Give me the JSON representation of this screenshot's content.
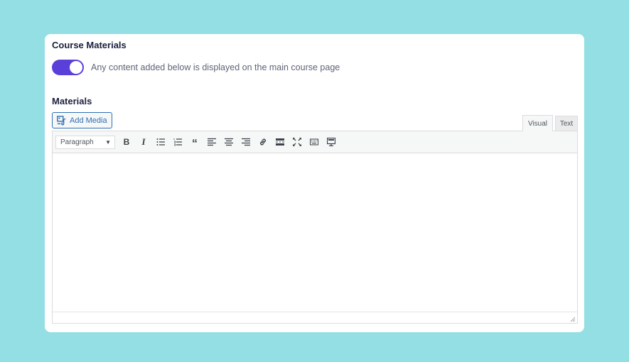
{
  "course_materials": {
    "title": "Course Materials",
    "toggle_on": true,
    "toggle_description": "Any content added below is displayed on the main course page"
  },
  "materials": {
    "title": "Materials",
    "add_media_label": "Add Media",
    "tabs": [
      {
        "label": "Visual",
        "active": true
      },
      {
        "label": "Text",
        "active": false
      }
    ],
    "format_select": {
      "value": "Paragraph"
    },
    "toolbar_icons": [
      "bold-icon",
      "italic-icon",
      "bulleted-list-icon",
      "numbered-list-icon",
      "blockquote-icon",
      "align-left-icon",
      "align-center-icon",
      "align-right-icon",
      "link-icon",
      "read-more-icon",
      "fullscreen-icon",
      "keyboard-icon",
      "toolbar-toggle-icon"
    ],
    "bold_glyph": "B",
    "italic_glyph": "I",
    "quote_glyph": "“"
  },
  "colors": {
    "background": "#93dfe4",
    "toggle": "#5b3fd9",
    "link": "#2f6fb3"
  }
}
